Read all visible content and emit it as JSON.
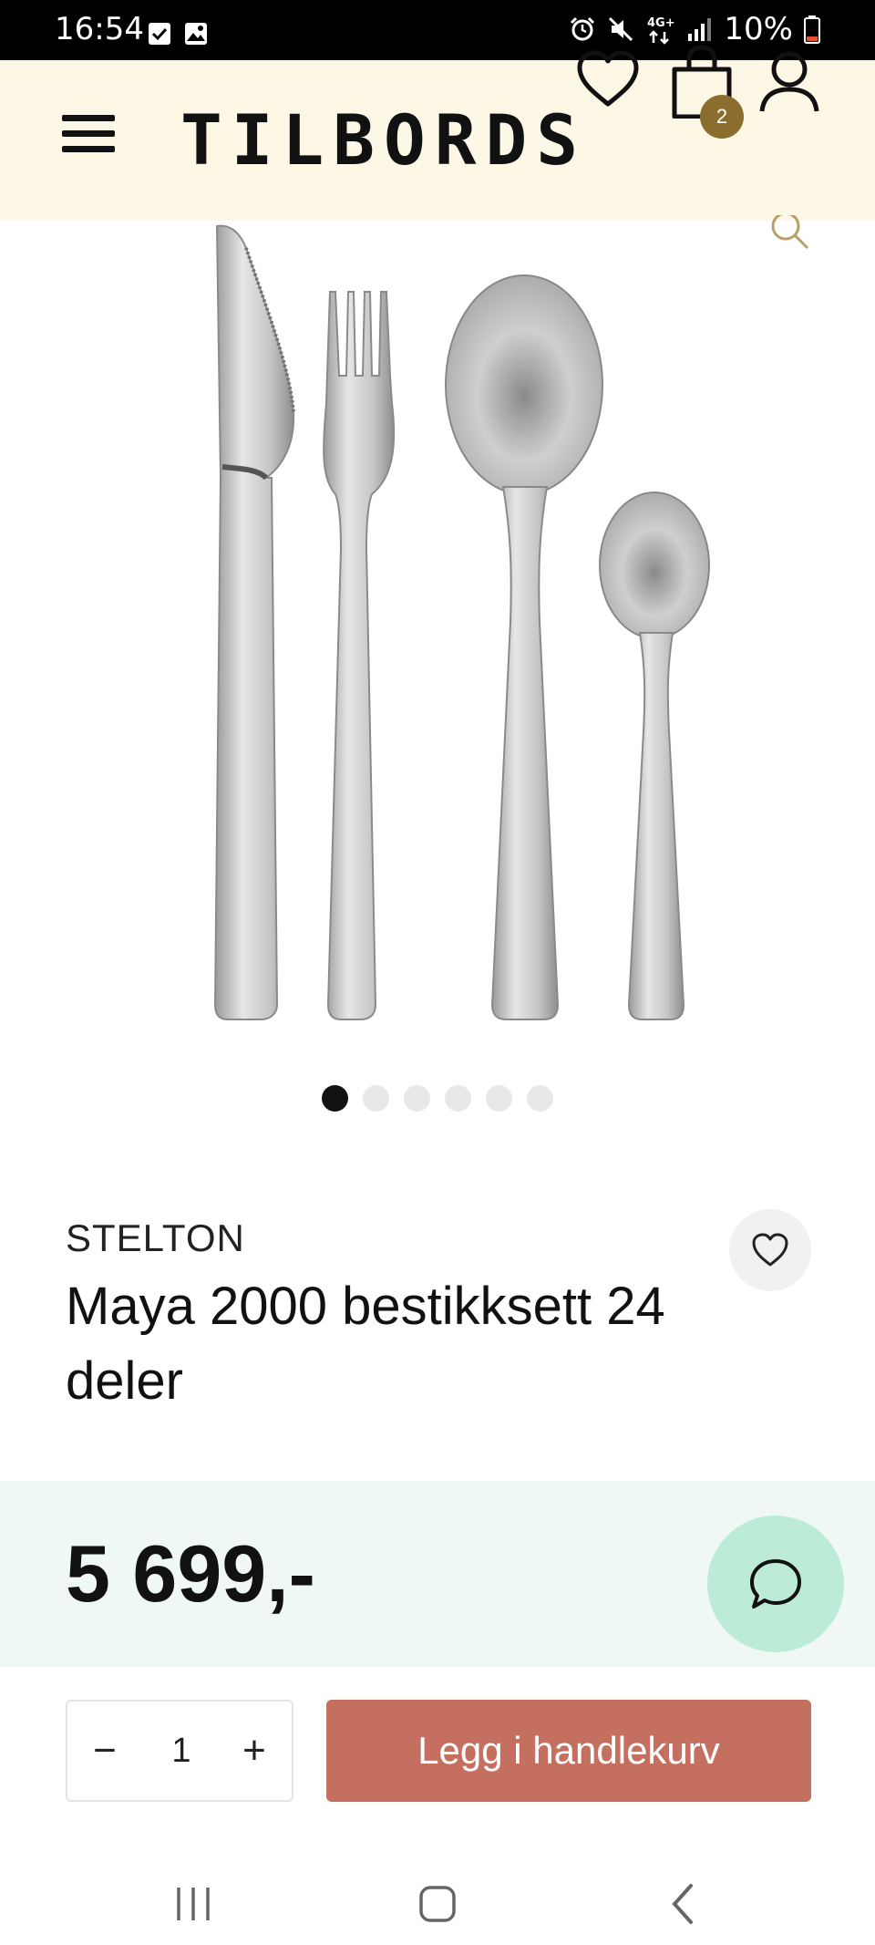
{
  "status_bar": {
    "time": "16:54",
    "battery": "10%",
    "network": "4G+",
    "icons": [
      "checkbox-notification-icon",
      "gallery-notification-icon",
      "alarm-icon",
      "mute-icon",
      "network-icon",
      "signal-icon",
      "battery-icon"
    ]
  },
  "header": {
    "logo": "TILBORDS",
    "cart_count": "2",
    "background": "#fdf7e6",
    "icons": [
      "menu-icon",
      "heart-icon",
      "shopping-bag-icon",
      "user-icon"
    ]
  },
  "gallery": {
    "image": "cutlery-set-image",
    "image_count": 6,
    "active_index": 0
  },
  "product": {
    "brand": "STELTON",
    "title": "Maya 2000 bestikksett 24 deler",
    "price": "5 699,-"
  },
  "purchase": {
    "quantity": "1",
    "minus": "−",
    "plus": "+",
    "add_to_cart": "Legg i handlekurv",
    "button_color": "#c56f60"
  },
  "chat": {
    "icon": "chat-bubble-icon",
    "color": "#bcebd7"
  },
  "nav": {
    "icons": [
      "recent-apps-icon",
      "home-icon",
      "back-icon"
    ]
  }
}
